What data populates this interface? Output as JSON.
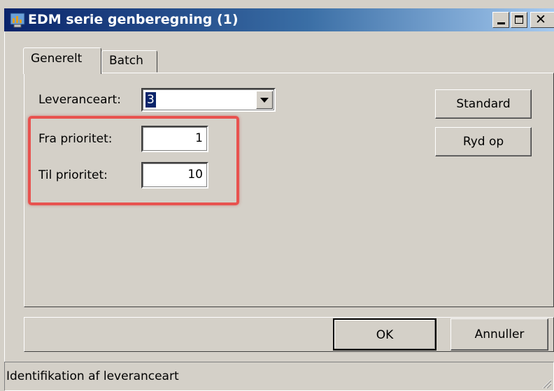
{
  "window": {
    "title": "EDM serie genberegning (1)"
  },
  "tabs": [
    {
      "label": "Generelt",
      "active": true
    },
    {
      "label": "Batch",
      "active": false
    }
  ],
  "form": {
    "leveranceart": {
      "label": "Leveranceart:",
      "value": "3"
    },
    "fra_prioritet": {
      "label": "Fra prioritet:",
      "value": "1"
    },
    "til_prioritet": {
      "label": "Til prioritet:",
      "value": "10"
    }
  },
  "side_buttons": {
    "standard": "Standard",
    "ryd_op": "Ryd op"
  },
  "footer_buttons": {
    "ok": "OK",
    "cancel": "Annuller"
  },
  "status": {
    "text": "Identifikation af leveranceart"
  },
  "colors": {
    "titlebar_start": "#0a246a",
    "titlebar_end": "#a6caf0",
    "highlight": "#e8524f",
    "face": "#d4d0c8"
  }
}
